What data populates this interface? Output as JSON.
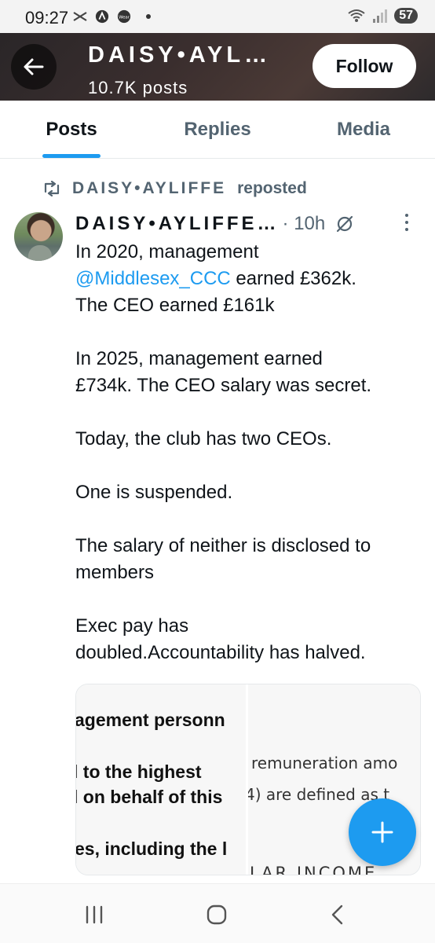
{
  "status_bar": {
    "time": "09:27",
    "battery": "57",
    "icons": [
      "network-icon",
      "app-icon",
      "wear-icon",
      "dot-icon",
      "wifi-icon",
      "signal-icon"
    ]
  },
  "header": {
    "title": "DAISY•AYL…",
    "subtitle": "10.7K posts",
    "follow_label": "Follow",
    "background_color": "#3a2e2e"
  },
  "tabs": [
    {
      "label": "Posts",
      "active": true
    },
    {
      "label": "Replies",
      "active": false
    },
    {
      "label": "Media",
      "active": false
    }
  ],
  "post": {
    "repost_name": "DAISY•AYLIFFE",
    "repost_suffix": "reposted",
    "author_name": "DAISY•AYLIFFE…",
    "time": "· 10h",
    "body": {
      "p1_line1": "In 2020, management",
      "p1_mention": "@Middlesex_CCC",
      "p1_line2_rest": " earned £362k.",
      "p1_line3": "The CEO earned £161k",
      "p2_line1": "In 2025, management earned",
      "p2_line2": "£734k. The CEO salary was secret.",
      "p3": "Today, the club has two CEOs.",
      "p4": "One is suspended.",
      "p5_line1": "The salary of neither is disclosed to",
      "p5_line2": "members",
      "p6_line1": "Exec pay has",
      "p6_line2": "doubled.Accountability has halved."
    },
    "media": {
      "image_a_lines": [
        "agement personn",
        "l  to  the  highest",
        "l on behalf of this",
        "es, including the l"
      ],
      "image_b_lines": [
        "remuneration amo",
        "4) are defined as t",
        "LAR INCOME"
      ]
    }
  },
  "colors": {
    "accent": "#1d9bf0",
    "muted_text": "#536471",
    "text": "#0f1419"
  }
}
